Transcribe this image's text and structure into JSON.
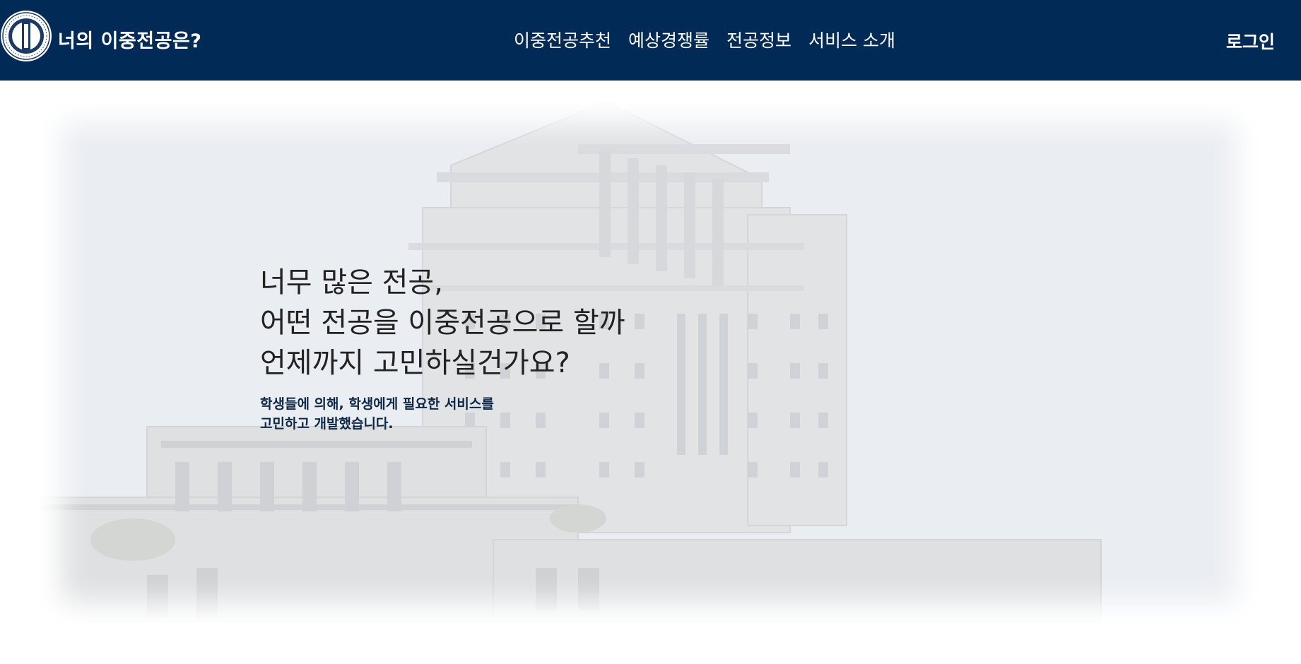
{
  "header": {
    "brand_title": "너의 이중전공은?",
    "nav": [
      {
        "label": "이중전공추천"
      },
      {
        "label": "예상경쟁률"
      },
      {
        "label": "전공정보"
      },
      {
        "label": "서비스 소개"
      }
    ],
    "login_label": "로그인",
    "background_color": "#012b56"
  },
  "hero": {
    "heading_lines": [
      "너무 많은 전공,",
      "어떤 전공을 이중전공으로 할까",
      "언제까지 고민하실건가요?"
    ],
    "sub_lines": [
      "학생들에 의해, 학생에게 필요한 서비스를",
      "고민하고 개발했습니다."
    ],
    "background_image": "university-building-photo"
  }
}
